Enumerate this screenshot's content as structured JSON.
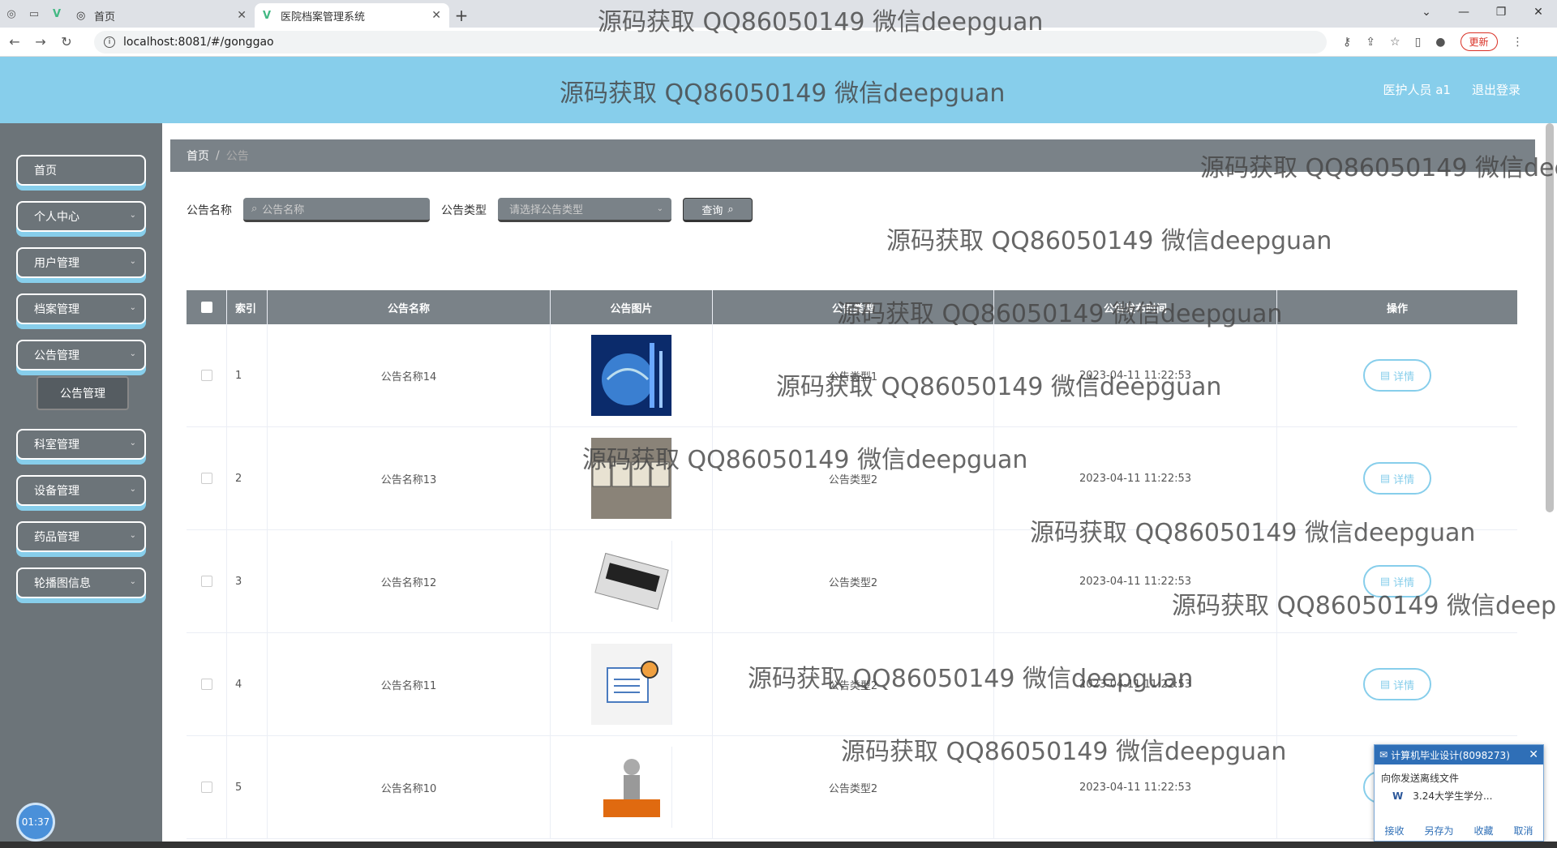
{
  "browser": {
    "tabs": [
      {
        "label": "首页"
      },
      {
        "label": "医院档案管理系统"
      }
    ],
    "url": "localhost:8081/#/gonggao",
    "update_label": "更新"
  },
  "header": {
    "user_label": "医护人员 a1",
    "logout_label": "退出登录"
  },
  "sidebar": {
    "items": [
      {
        "label": "首页"
      },
      {
        "label": "个人中心"
      },
      {
        "label": "用户管理"
      },
      {
        "label": "档案管理"
      },
      {
        "label": "公告管理"
      },
      {
        "label": "科室管理"
      },
      {
        "label": "设备管理"
      },
      {
        "label": "药品管理"
      },
      {
        "label": "轮播图信息"
      }
    ],
    "sub_item": "公告管理",
    "clock": "01:37"
  },
  "breadcrumb": {
    "home": "首页",
    "sep": "/",
    "current": "公告"
  },
  "search": {
    "name_label": "公告名称",
    "name_placeholder": "公告名称",
    "type_label": "公告类型",
    "type_placeholder": "请选择公告类型",
    "query_label": "查询"
  },
  "table": {
    "headers": [
      "索引",
      "公告名称",
      "公告图片",
      "公告类型",
      "公告发布时间",
      "操作"
    ],
    "rows": [
      {
        "index": "1",
        "name": "公告名称14",
        "type": "公告类型1",
        "time": "2023-04-11 11:22:53"
      },
      {
        "index": "2",
        "name": "公告名称13",
        "type": "公告类型2",
        "time": "2023-04-11 11:22:53"
      },
      {
        "index": "3",
        "name": "公告名称12",
        "type": "公告类型2",
        "time": "2023-04-11 11:22:53"
      },
      {
        "index": "4",
        "name": "公告名称11",
        "type": "公告类型2",
        "time": "2023-04-11 11:22:53"
      },
      {
        "index": "5",
        "name": "公告名称10",
        "type": "公告类型2",
        "time": "2023-04-11 11:22:53"
      }
    ],
    "detail_label": "详情"
  },
  "watermark": "源码获取 QQ86050149 微信deepguan",
  "popup": {
    "title": "计算机毕业设计(8098273)",
    "message": "向你发送离线文件",
    "file": "3.24大学生学分...",
    "actions": [
      "接收",
      "另存为",
      "收藏",
      "取消"
    ]
  },
  "colors": {
    "header": "#87ceeb",
    "sidebar": "#6c7479",
    "accent": "#87ceeb"
  }
}
